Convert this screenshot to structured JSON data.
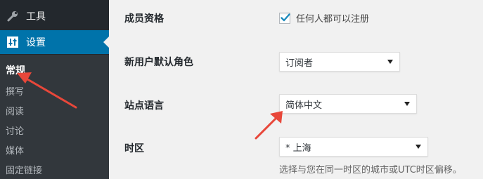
{
  "sidebar": {
    "tools_label": "工具",
    "settings_label": "设置",
    "submenu": [
      {
        "label": "常规",
        "current": true
      },
      {
        "label": "撰写"
      },
      {
        "label": "阅读"
      },
      {
        "label": "讨论"
      },
      {
        "label": "媒体"
      },
      {
        "label": "固定链接"
      }
    ]
  },
  "form": {
    "membership": {
      "label": "成员资格",
      "checkbox_label": "任何人都可以注册",
      "checked": true
    },
    "default_role": {
      "label": "新用户默认角色",
      "value": "订阅者"
    },
    "site_language": {
      "label": "站点语言",
      "value": "简体中文"
    },
    "timezone": {
      "label": "时区",
      "value": "* 上海",
      "description": "选择与您在同一时区的城市或UTC时区偏移。"
    }
  },
  "colors": {
    "accent": "#0073aa",
    "sidebar_bg": "#23282d",
    "annotation": "#e8473a"
  }
}
